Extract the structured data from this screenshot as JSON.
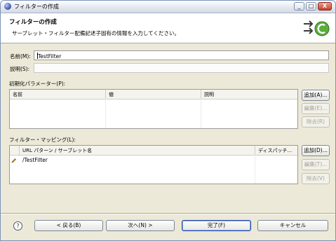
{
  "window": {
    "title": "フィルターの作成",
    "buttons": {
      "minimize": "_",
      "maximize": "□",
      "close": "X"
    }
  },
  "header": {
    "title": "フィルターの作成",
    "description": "サーブレット・フィルター配備記述子固有の情報を入力してください。",
    "icon": "wizard-filter-icon"
  },
  "form": {
    "name_label": "名前(M):",
    "name_value": "TestFilter",
    "description_label": "説明(S):",
    "description_value": ""
  },
  "init_params": {
    "label": "初期化パラメーター(P):",
    "columns": [
      "名前",
      "値",
      "説明"
    ],
    "rows": [],
    "buttons": {
      "add": "追加(A)...",
      "edit": "編集(E)...",
      "remove": "除去(R)"
    }
  },
  "mappings": {
    "label": "フィルター・マッピング(L):",
    "columns": [
      "URL パターン / サーブレット名",
      "ディスパッチ..."
    ],
    "rows": [
      {
        "icon": "pencil-icon",
        "pattern": "/TestFilter",
        "dispatch": ""
      }
    ],
    "buttons": {
      "add": "追加(D)...",
      "edit": "編集(T)...",
      "remove": "除去(V)"
    }
  },
  "footer": {
    "help_glyph": "?",
    "back": "< 戻る(B)",
    "next": "次へ(N) >",
    "finish": "完了(F)",
    "cancel": "キャンセル"
  }
}
